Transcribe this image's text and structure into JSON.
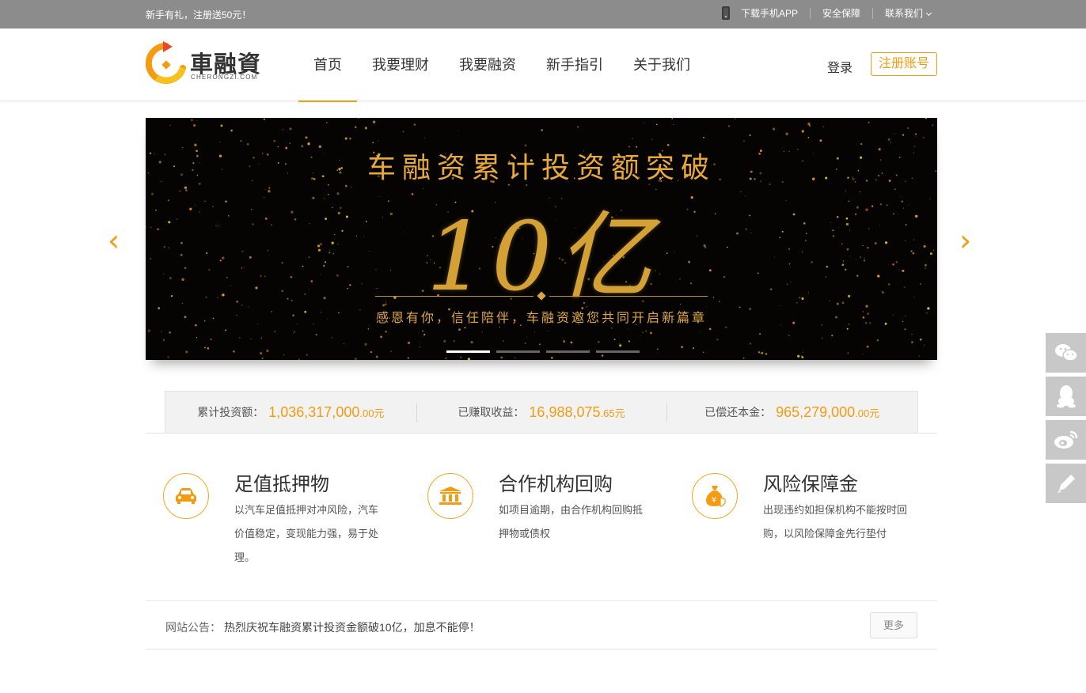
{
  "topbar": {
    "promo": "新手有礼，注册送50元！",
    "download_app": "下载手机APP",
    "security": "安全保障",
    "contact": "联系我们"
  },
  "header": {
    "logo_text": "車融資",
    "logo_sub": "CHERONGZI.COM",
    "nav": [
      "首页",
      "我要理财",
      "我要融资",
      "新手指引",
      "关于我们"
    ],
    "login": "登录",
    "register": "注册账号",
    "accent_color": "#f39c12"
  },
  "banner": {
    "title": "车融资累计投资额突破",
    "big_text": "10亿",
    "subtitle": "感恩有你，信任陪伴，车融资邀您共同开启新篇章",
    "slide_count": 4,
    "active_slide": 1,
    "prev_arrow": "‹",
    "next_arrow": "›"
  },
  "stats": [
    {
      "label": "累计投资额：",
      "value_main": "1,036,317,000",
      "value_dec": ".00元"
    },
    {
      "label": "已赚取收益：",
      "value_main": "16,988,075",
      "value_dec": ".65元"
    },
    {
      "label": "已偿还本金：",
      "value_main": "965,279,000",
      "value_dec": ".00元"
    }
  ],
  "features": [
    {
      "icon": "car-icon",
      "title": "足值抵押物",
      "desc": "以汽车足值抵押对冲风险，汽车价值稳定，变现能力强，易于处理。"
    },
    {
      "icon": "bank-icon",
      "title": "合作机构回购",
      "desc": "如项目逾期，由合作机构回购抵押物或债权"
    },
    {
      "icon": "money-bag-icon",
      "title": "风险保障金",
      "desc": "出现违约如担保机构不能按时回购，以风险保障金先行垫付"
    }
  ],
  "notice": {
    "label": "网站公告：",
    "text": "热烈庆祝车融资累计投资金额破10亿，加息不能停！",
    "more": "更多"
  },
  "side_buttons": [
    "wechat-icon",
    "qq-icon",
    "weibo-icon",
    "edit-icon"
  ]
}
